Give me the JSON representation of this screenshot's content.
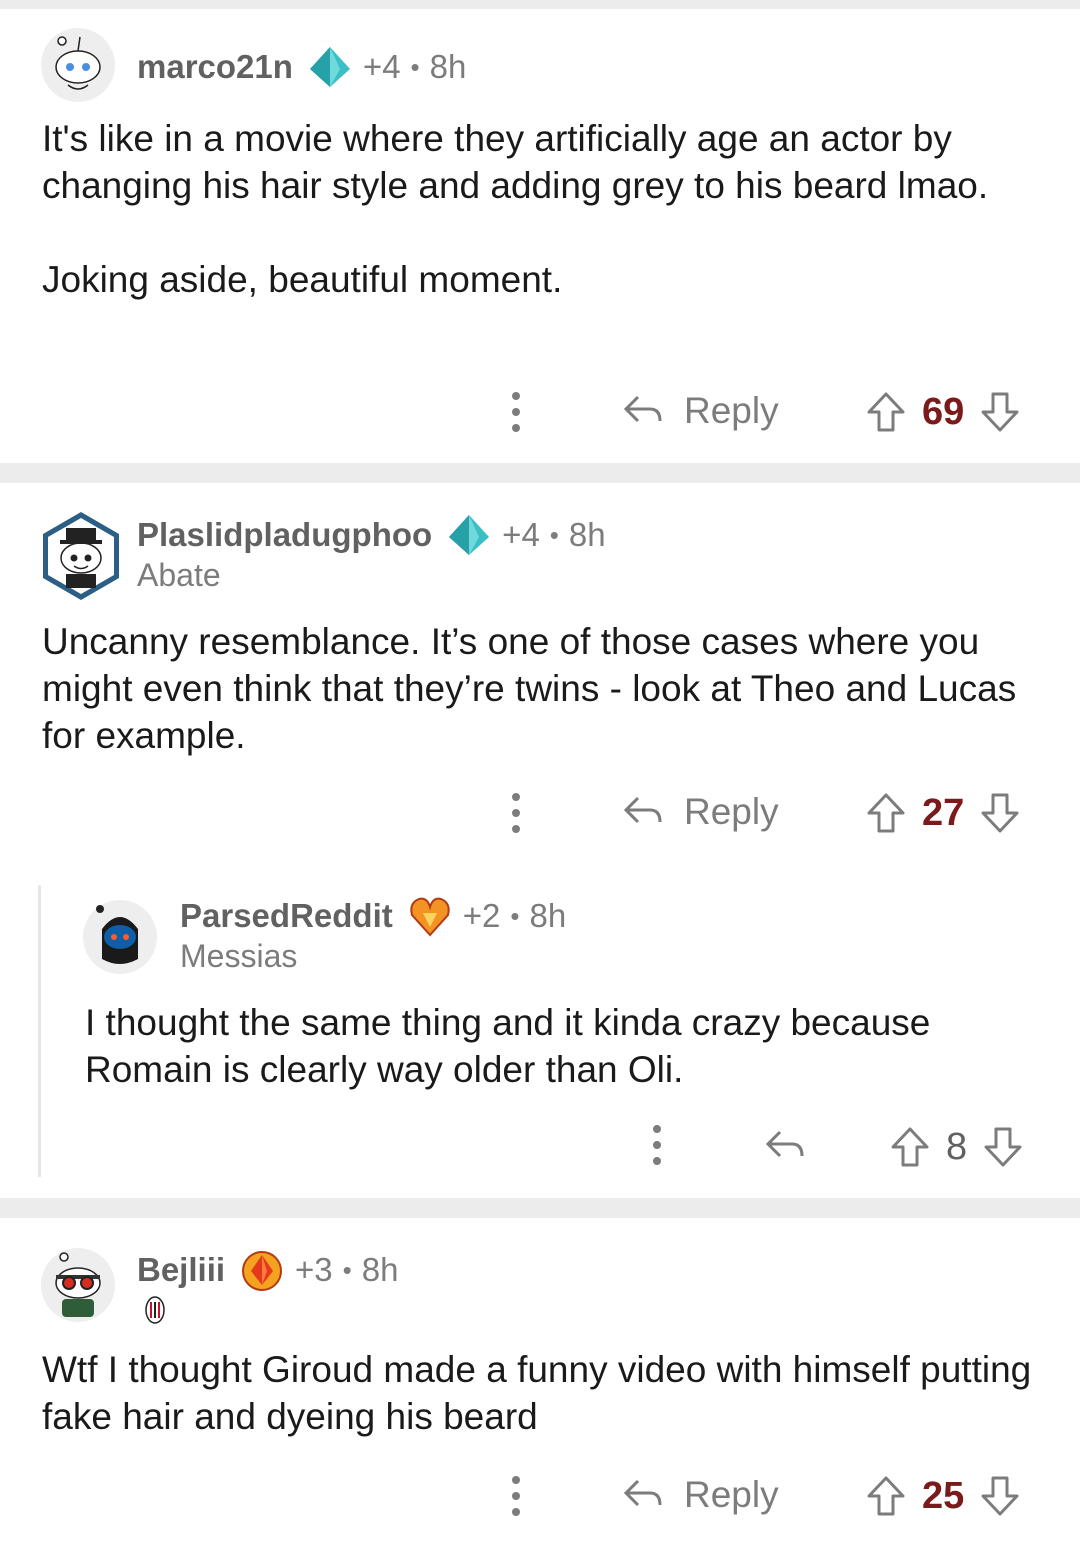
{
  "colors": {
    "separator": "#ececec",
    "upvoted_score": "#7a1a1a",
    "meta_gray": "#7c7c7c"
  },
  "comments": [
    {
      "user": "marco21n",
      "award_icon": "diamond-award-icon",
      "award_count": "+4",
      "time": "8h",
      "flair": "",
      "body": "It's like in a movie where they artificially age an actor by changing his hair style and adding grey to his beard lmao.\n\nJoking aside, beautiful moment.",
      "reply_label": "Reply",
      "score": "69"
    },
    {
      "user": "Plaslidpladugphoo",
      "award_icon": "diamond-award-icon",
      "award_count": "+4",
      "time": "8h",
      "flair": "Abate",
      "body": "Uncanny resemblance. It’s one of those cases where you might even think that they’re twins - look at Theo and Lucas for example.",
      "reply_label": "Reply",
      "score": "27"
    },
    {
      "user": "ParsedReddit",
      "award_icon": "fire-heart-award-icon",
      "award_count": "+2",
      "time": "8h",
      "flair": "Messias",
      "body": "I thought the same thing and it kinda crazy because Romain is clearly way older than Oli.",
      "score": "8"
    },
    {
      "user": "Bejliii",
      "award_icon": "fire-gem-award-icon",
      "award_count": "+3",
      "time": "8h",
      "flair_icon": "ac-milan-crest-icon",
      "body": "Wtf I thought Giroud made a funny video with himself putting fake hair and dyeing his beard",
      "reply_label": "Reply",
      "score": "25"
    }
  ]
}
